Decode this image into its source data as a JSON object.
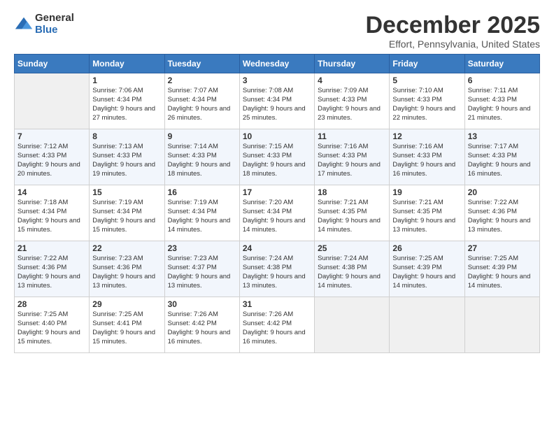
{
  "logo": {
    "general": "General",
    "blue": "Blue"
  },
  "title": "December 2025",
  "location": "Effort, Pennsylvania, United States",
  "days_of_week": [
    "Sunday",
    "Monday",
    "Tuesday",
    "Wednesday",
    "Thursday",
    "Friday",
    "Saturday"
  ],
  "weeks": [
    [
      {
        "day": "",
        "sunrise": "",
        "sunset": "",
        "daylight": ""
      },
      {
        "day": "1",
        "sunrise": "Sunrise: 7:06 AM",
        "sunset": "Sunset: 4:34 PM",
        "daylight": "Daylight: 9 hours and 27 minutes."
      },
      {
        "day": "2",
        "sunrise": "Sunrise: 7:07 AM",
        "sunset": "Sunset: 4:34 PM",
        "daylight": "Daylight: 9 hours and 26 minutes."
      },
      {
        "day": "3",
        "sunrise": "Sunrise: 7:08 AM",
        "sunset": "Sunset: 4:34 PM",
        "daylight": "Daylight: 9 hours and 25 minutes."
      },
      {
        "day": "4",
        "sunrise": "Sunrise: 7:09 AM",
        "sunset": "Sunset: 4:33 PM",
        "daylight": "Daylight: 9 hours and 23 minutes."
      },
      {
        "day": "5",
        "sunrise": "Sunrise: 7:10 AM",
        "sunset": "Sunset: 4:33 PM",
        "daylight": "Daylight: 9 hours and 22 minutes."
      },
      {
        "day": "6",
        "sunrise": "Sunrise: 7:11 AM",
        "sunset": "Sunset: 4:33 PM",
        "daylight": "Daylight: 9 hours and 21 minutes."
      }
    ],
    [
      {
        "day": "7",
        "sunrise": "Sunrise: 7:12 AM",
        "sunset": "Sunset: 4:33 PM",
        "daylight": "Daylight: 9 hours and 20 minutes."
      },
      {
        "day": "8",
        "sunrise": "Sunrise: 7:13 AM",
        "sunset": "Sunset: 4:33 PM",
        "daylight": "Daylight: 9 hours and 19 minutes."
      },
      {
        "day": "9",
        "sunrise": "Sunrise: 7:14 AM",
        "sunset": "Sunset: 4:33 PM",
        "daylight": "Daylight: 9 hours and 18 minutes."
      },
      {
        "day": "10",
        "sunrise": "Sunrise: 7:15 AM",
        "sunset": "Sunset: 4:33 PM",
        "daylight": "Daylight: 9 hours and 18 minutes."
      },
      {
        "day": "11",
        "sunrise": "Sunrise: 7:16 AM",
        "sunset": "Sunset: 4:33 PM",
        "daylight": "Daylight: 9 hours and 17 minutes."
      },
      {
        "day": "12",
        "sunrise": "Sunrise: 7:16 AM",
        "sunset": "Sunset: 4:33 PM",
        "daylight": "Daylight: 9 hours and 16 minutes."
      },
      {
        "day": "13",
        "sunrise": "Sunrise: 7:17 AM",
        "sunset": "Sunset: 4:33 PM",
        "daylight": "Daylight: 9 hours and 16 minutes."
      }
    ],
    [
      {
        "day": "14",
        "sunrise": "Sunrise: 7:18 AM",
        "sunset": "Sunset: 4:34 PM",
        "daylight": "Daylight: 9 hours and 15 minutes."
      },
      {
        "day": "15",
        "sunrise": "Sunrise: 7:19 AM",
        "sunset": "Sunset: 4:34 PM",
        "daylight": "Daylight: 9 hours and 15 minutes."
      },
      {
        "day": "16",
        "sunrise": "Sunrise: 7:19 AM",
        "sunset": "Sunset: 4:34 PM",
        "daylight": "Daylight: 9 hours and 14 minutes."
      },
      {
        "day": "17",
        "sunrise": "Sunrise: 7:20 AM",
        "sunset": "Sunset: 4:34 PM",
        "daylight": "Daylight: 9 hours and 14 minutes."
      },
      {
        "day": "18",
        "sunrise": "Sunrise: 7:21 AM",
        "sunset": "Sunset: 4:35 PM",
        "daylight": "Daylight: 9 hours and 14 minutes."
      },
      {
        "day": "19",
        "sunrise": "Sunrise: 7:21 AM",
        "sunset": "Sunset: 4:35 PM",
        "daylight": "Daylight: 9 hours and 13 minutes."
      },
      {
        "day": "20",
        "sunrise": "Sunrise: 7:22 AM",
        "sunset": "Sunset: 4:36 PM",
        "daylight": "Daylight: 9 hours and 13 minutes."
      }
    ],
    [
      {
        "day": "21",
        "sunrise": "Sunrise: 7:22 AM",
        "sunset": "Sunset: 4:36 PM",
        "daylight": "Daylight: 9 hours and 13 minutes."
      },
      {
        "day": "22",
        "sunrise": "Sunrise: 7:23 AM",
        "sunset": "Sunset: 4:36 PM",
        "daylight": "Daylight: 9 hours and 13 minutes."
      },
      {
        "day": "23",
        "sunrise": "Sunrise: 7:23 AM",
        "sunset": "Sunset: 4:37 PM",
        "daylight": "Daylight: 9 hours and 13 minutes."
      },
      {
        "day": "24",
        "sunrise": "Sunrise: 7:24 AM",
        "sunset": "Sunset: 4:38 PM",
        "daylight": "Daylight: 9 hours and 13 minutes."
      },
      {
        "day": "25",
        "sunrise": "Sunrise: 7:24 AM",
        "sunset": "Sunset: 4:38 PM",
        "daylight": "Daylight: 9 hours and 14 minutes."
      },
      {
        "day": "26",
        "sunrise": "Sunrise: 7:25 AM",
        "sunset": "Sunset: 4:39 PM",
        "daylight": "Daylight: 9 hours and 14 minutes."
      },
      {
        "day": "27",
        "sunrise": "Sunrise: 7:25 AM",
        "sunset": "Sunset: 4:39 PM",
        "daylight": "Daylight: 9 hours and 14 minutes."
      }
    ],
    [
      {
        "day": "28",
        "sunrise": "Sunrise: 7:25 AM",
        "sunset": "Sunset: 4:40 PM",
        "daylight": "Daylight: 9 hours and 15 minutes."
      },
      {
        "day": "29",
        "sunrise": "Sunrise: 7:25 AM",
        "sunset": "Sunset: 4:41 PM",
        "daylight": "Daylight: 9 hours and 15 minutes."
      },
      {
        "day": "30",
        "sunrise": "Sunrise: 7:26 AM",
        "sunset": "Sunset: 4:42 PM",
        "daylight": "Daylight: 9 hours and 16 minutes."
      },
      {
        "day": "31",
        "sunrise": "Sunrise: 7:26 AM",
        "sunset": "Sunset: 4:42 PM",
        "daylight": "Daylight: 9 hours and 16 minutes."
      },
      {
        "day": "",
        "sunrise": "",
        "sunset": "",
        "daylight": ""
      },
      {
        "day": "",
        "sunrise": "",
        "sunset": "",
        "daylight": ""
      },
      {
        "day": "",
        "sunrise": "",
        "sunset": "",
        "daylight": ""
      }
    ]
  ]
}
